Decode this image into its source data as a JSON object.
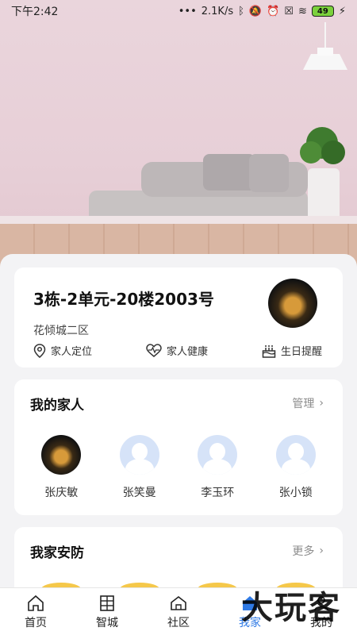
{
  "status_bar": {
    "time": "下午2:42",
    "network_speed": "2.1K/s",
    "battery": "49"
  },
  "home_card": {
    "address": "3栋-2单元-20楼2003号",
    "community": "花倾城二区",
    "actions": [
      {
        "label": "家人定位",
        "icon": "location-pin-icon"
      },
      {
        "label": "家人健康",
        "icon": "heart-pulse-icon"
      },
      {
        "label": "生日提醒",
        "icon": "birthday-cake-icon"
      }
    ]
  },
  "family_card": {
    "title": "我的家人",
    "manage_label": "管理",
    "members": [
      {
        "name": "张庆敏",
        "avatar": "photo"
      },
      {
        "name": "张笑曼",
        "avatar": "default"
      },
      {
        "name": "李玉环",
        "avatar": "default"
      },
      {
        "name": "张小锁",
        "avatar": "default"
      }
    ]
  },
  "security_card": {
    "title": "我家安防",
    "more_label": "更多"
  },
  "tab_bar": {
    "tabs": [
      {
        "label": "首页",
        "icon": "home-icon",
        "active": false
      },
      {
        "label": "智城",
        "icon": "city-building-icon",
        "active": false
      },
      {
        "label": "社区",
        "icon": "community-house-icon",
        "active": false
      },
      {
        "label": "我家",
        "icon": "my-home-icon",
        "active": true
      },
      {
        "label": "我的",
        "icon": "profile-icon",
        "active": false
      }
    ]
  },
  "watermark": "大玩客",
  "colors": {
    "accent": "#2f7ae5",
    "avatar_placeholder": "#d6e3f8",
    "security_icon": "#f5c84a"
  }
}
